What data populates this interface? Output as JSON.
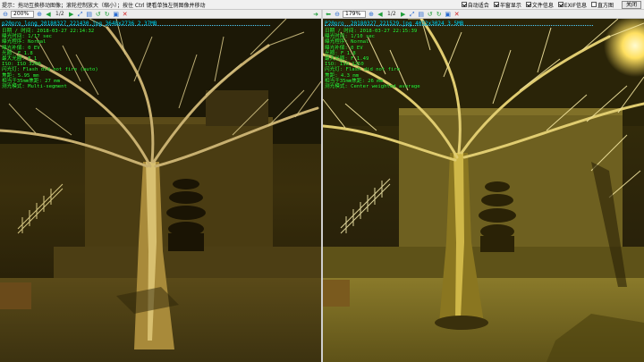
{
  "topbar": {
    "hint": "提示：拖动互换移动图像；滚轮控制放大（缩小）；按住 Ctrl 键看单独左侧图像并移动",
    "options": [
      {
        "label": "自动适合",
        "checked": true
      },
      {
        "label": "半窗显示",
        "checked": true
      },
      {
        "label": "文件信息",
        "checked": true
      },
      {
        "label": "EXIF信息",
        "checked": true
      },
      {
        "label": "直方图",
        "checked": false
      }
    ],
    "close_label": "关闭"
  },
  "left": {
    "zoom": "200%",
    "page": "1/2",
    "filename": "p20pro_long_20180327_221430.jpg   3648x2736   2.37MB",
    "exif": [
      "日期 / 时间: 2018-03-27 22:14:32",
      "曝光时间: 1/17 sec",
      "曝光程序: Normal",
      "曝光补偿: 0 EV",
      "光圈: F 1.8",
      "最大光圈: F 1",
      "ISO: ISO 3200",
      "闪光灯: Flash did not fire (auto)",
      "焦距: 5.95 mm",
      "相当于35mm焦距: 27 mm",
      "测光模式: Multi-segment"
    ]
  },
  "right": {
    "zoom": "179%",
    "page": "1/2",
    "filename": "P20pro__20180327_221529.jpg   4032x3024   3.5MB",
    "exif": [
      "日期 / 时间: 2018-03-27 22:15:39",
      "曝光时间: 1/10 sec",
      "曝光程序: Normal",
      "曝光补偿: 0 EV",
      "光圈: F 1.8",
      "最大光圈: F 1.49",
      "ISO: ISO 1250",
      "闪光灯: Flash did not fire",
      "焦距: 4.3 mm",
      "相当于35mm焦距: 26 mm",
      "测光模式: Center weighted average"
    ]
  },
  "colors": {
    "exif_text": "#2fff3a",
    "filename_text": "#00e0ff",
    "left_tint": "#6b5a20",
    "right_tint": "#7a6a14"
  }
}
